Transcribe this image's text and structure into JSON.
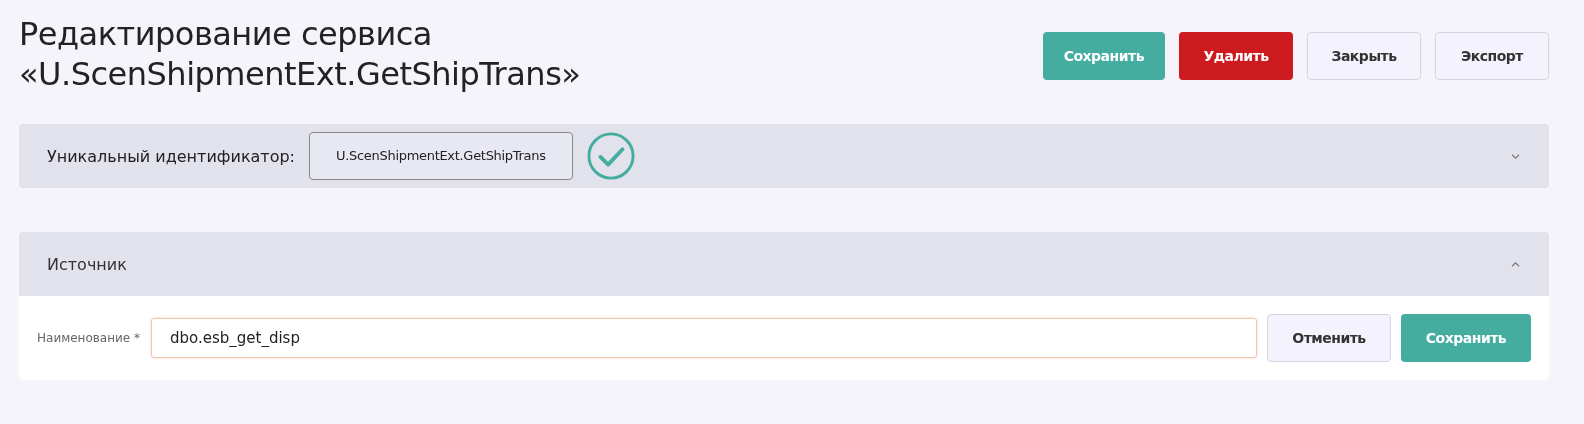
{
  "title": "Редактирование сервиса «U.ScenShipmentExt.GetShipTrans»",
  "actions": [
    {
      "label": "Сохранить",
      "kind": "primary"
    },
    {
      "label": "Удалить",
      "kind": "danger"
    },
    {
      "label": "Закрыть",
      "kind": "secondary"
    },
    {
      "label": "Экспорт",
      "kind": "secondary"
    }
  ],
  "identifier": {
    "label": "Уникальный идентификатор:",
    "value": "U.ScenShipmentExt.GetShipTrans",
    "valid": true,
    "expanded": false
  },
  "source": {
    "title": "Источник",
    "expanded": true,
    "field_label": "Наименование *",
    "field_value": "dbo.esb_get_disp",
    "buttons": [
      {
        "label": "Отменить",
        "kind": "secondary"
      },
      {
        "label": "Сохранить",
        "kind": "primary"
      }
    ]
  }
}
